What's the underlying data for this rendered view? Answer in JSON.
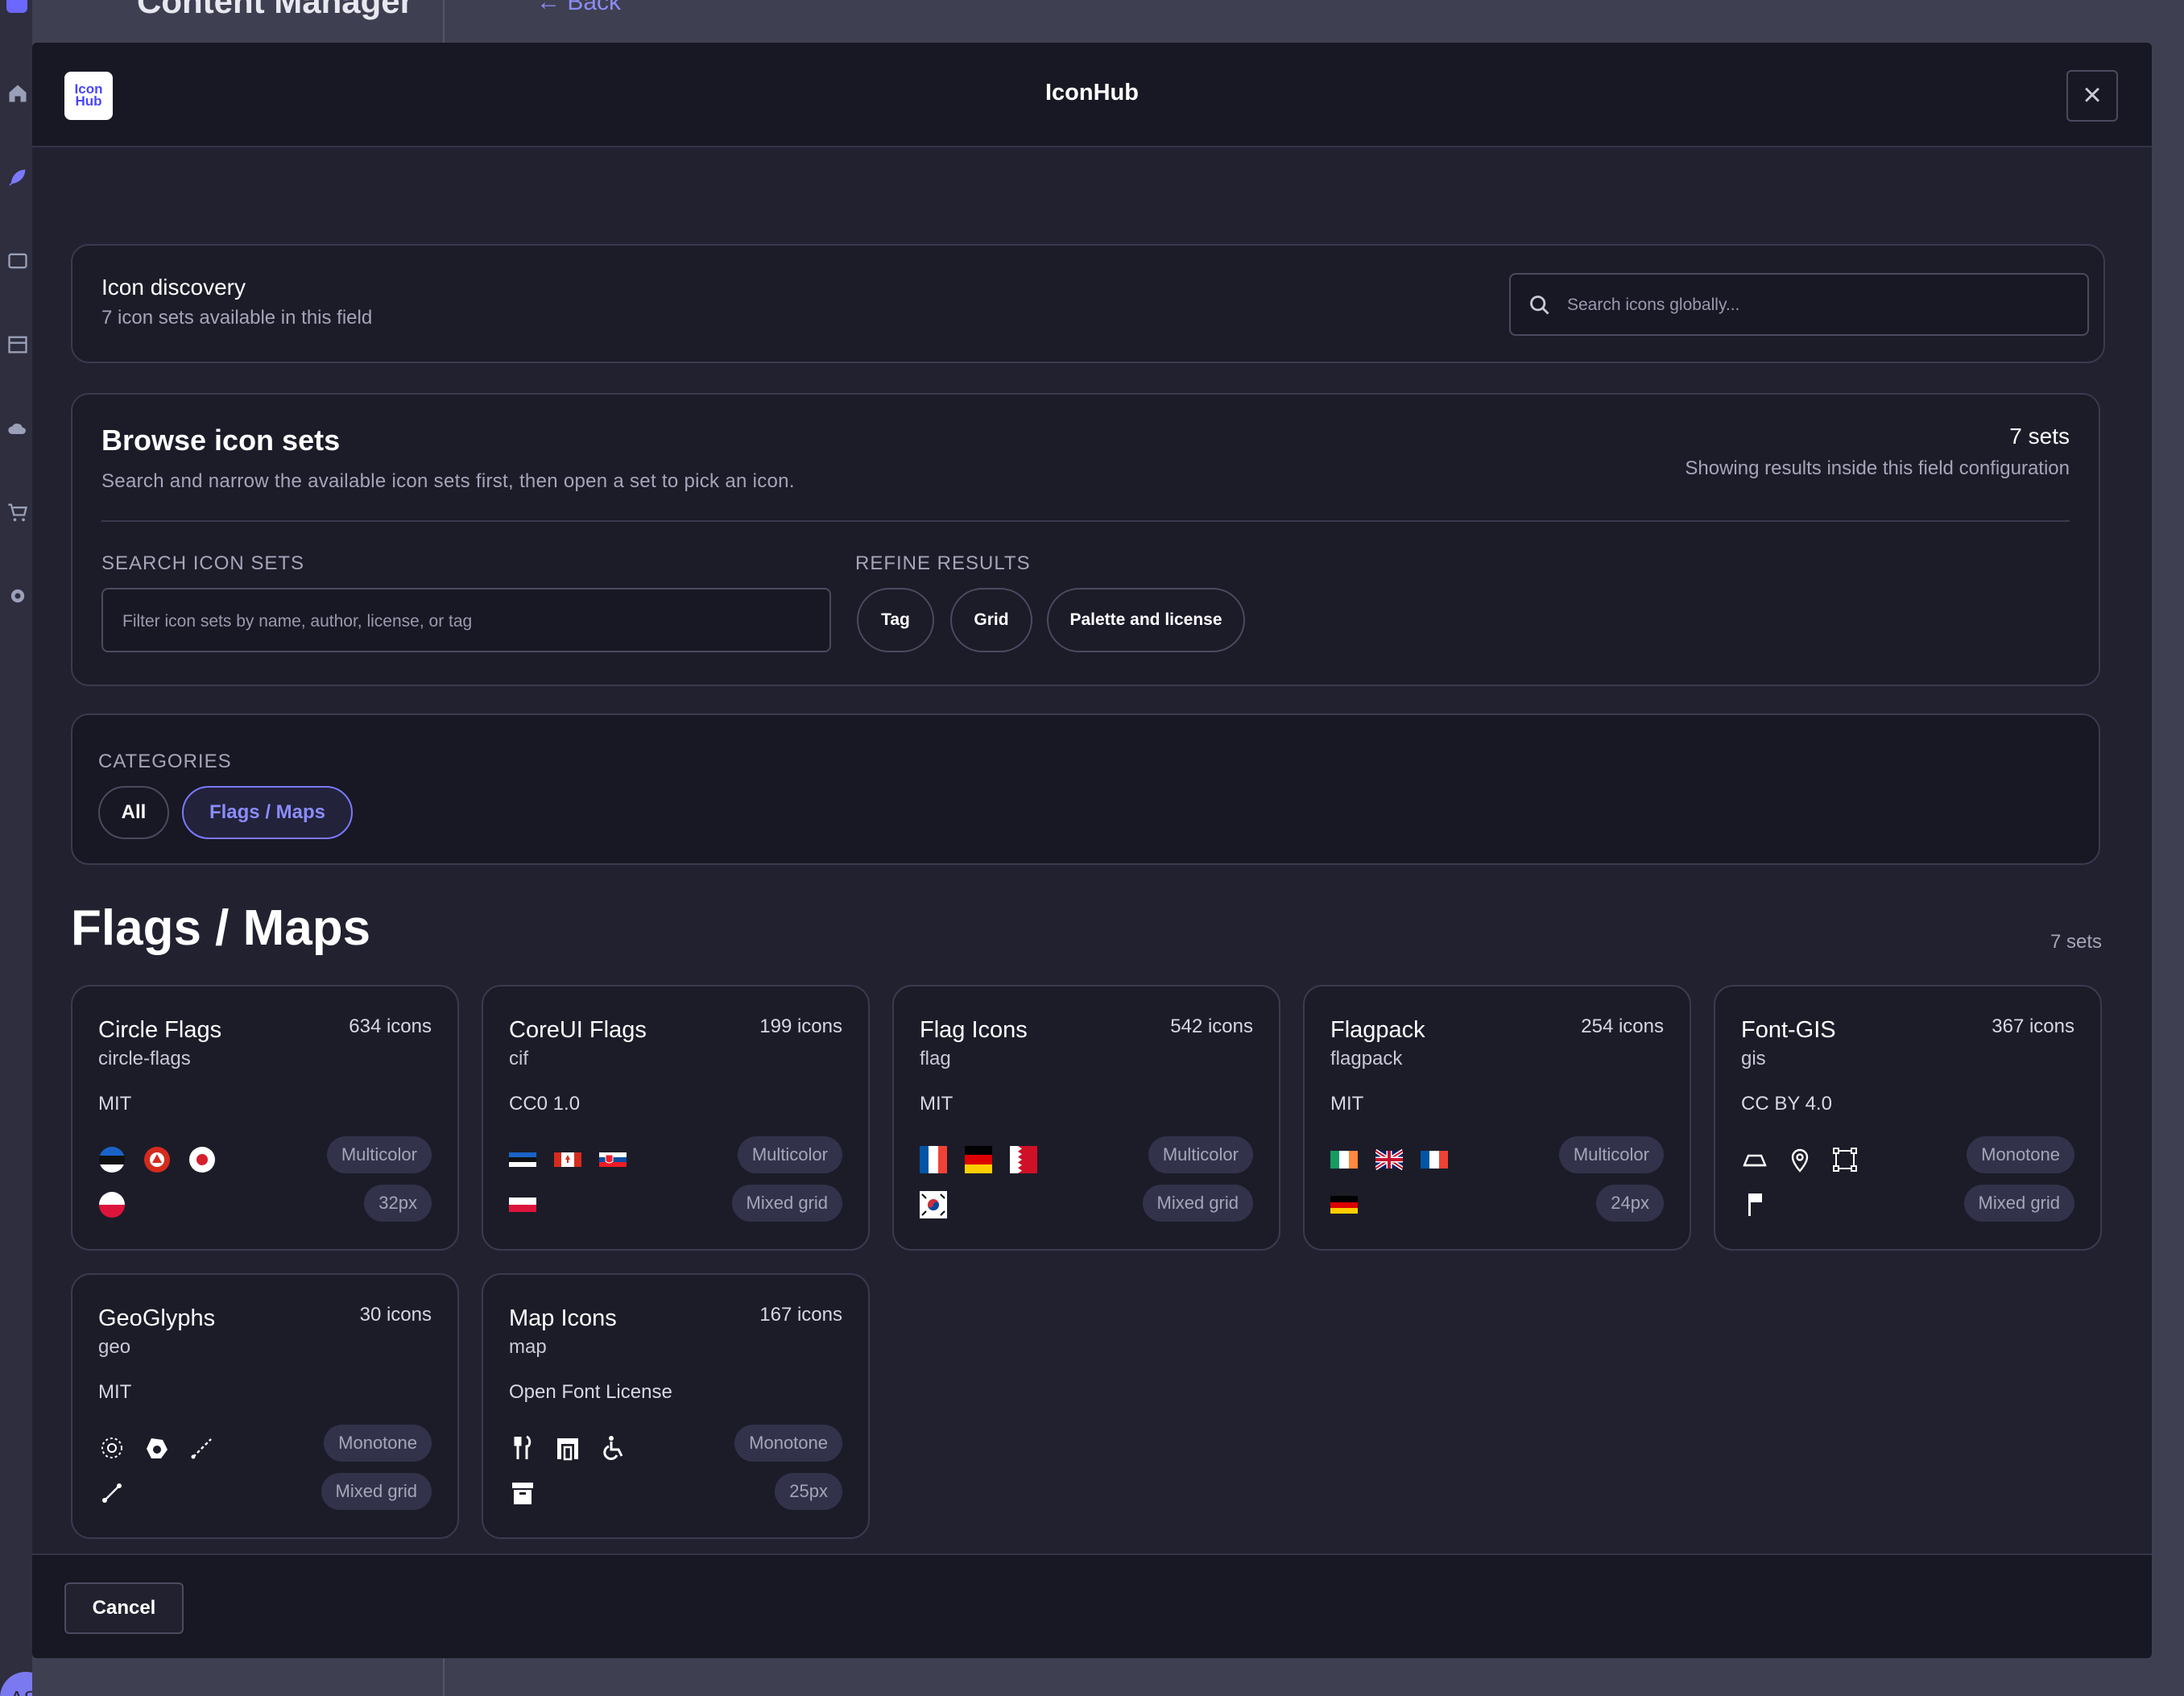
{
  "background": {
    "nav_title": "Content Manager",
    "back_label": "Back",
    "avatar_initials": "AS"
  },
  "modal": {
    "title": "IconHub",
    "logo_line1": "Icon",
    "logo_line2": "Hub",
    "close_glyph": "×"
  },
  "discovery": {
    "title": "Icon discovery",
    "subtitle": "7 icon sets available in this field",
    "search_placeholder": "Search icons globally..."
  },
  "browse": {
    "title": "Browse icon sets",
    "subtitle": "Search and narrow the available icon sets first, then open a set to pick an icon.",
    "count": "7 sets",
    "count_sub": "Showing results inside this field configuration",
    "search_label": "SEARCH ICON SETS",
    "search_placeholder": "Filter icon sets by name, author, license, or tag",
    "refine_label": "REFINE RESULTS",
    "refine_buttons": [
      "Tag",
      "Grid",
      "Palette and license"
    ]
  },
  "categories": {
    "label": "CATEGORIES",
    "items": [
      "All",
      "Flags / Maps"
    ],
    "selected": "Flags / Maps"
  },
  "section": {
    "title": "Flags / Maps",
    "count": "7 sets"
  },
  "sets": [
    {
      "name": "Circle Flags",
      "prefix": "circle-flags",
      "count": "634 icons",
      "license": "MIT",
      "palette": "Multicolor",
      "grid": "32px"
    },
    {
      "name": "CoreUI Flags",
      "prefix": "cif",
      "count": "199 icons",
      "license": "CC0 1.0",
      "palette": "Multicolor",
      "grid": "Mixed grid"
    },
    {
      "name": "Flag Icons",
      "prefix": "flag",
      "count": "542 icons",
      "license": "MIT",
      "palette": "Multicolor",
      "grid": "Mixed grid"
    },
    {
      "name": "Flagpack",
      "prefix": "flagpack",
      "count": "254 icons",
      "license": "MIT",
      "palette": "Multicolor",
      "grid": "24px"
    },
    {
      "name": "Font-GIS",
      "prefix": "gis",
      "count": "367 icons",
      "license": "CC BY 4.0",
      "palette": "Monotone",
      "grid": "Mixed grid"
    },
    {
      "name": "GeoGlyphs",
      "prefix": "geo",
      "count": "30 icons",
      "license": "MIT",
      "palette": "Monotone",
      "grid": "Mixed grid"
    },
    {
      "name": "Map Icons",
      "prefix": "map",
      "count": "167 icons",
      "license": "Open Font License",
      "palette": "Monotone",
      "grid": "25px"
    }
  ],
  "footer": {
    "cancel_label": "Cancel"
  },
  "colors": {
    "accent": "#7b79ff",
    "modal_bg": "#212130",
    "card_bg": "#1c1c29"
  }
}
